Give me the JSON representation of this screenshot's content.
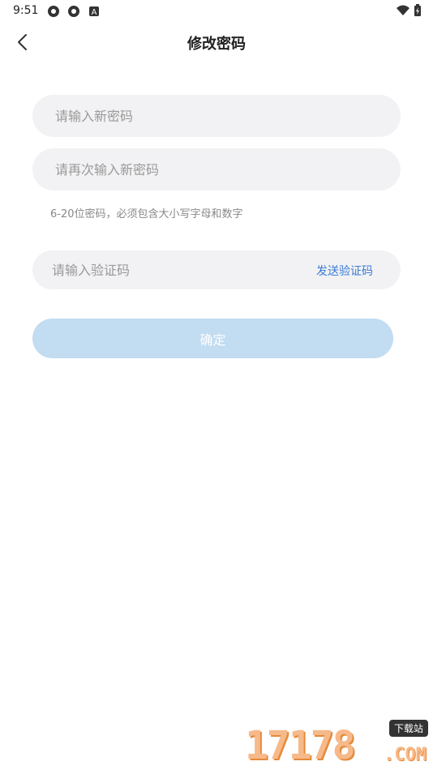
{
  "status_bar": {
    "time": "9:51",
    "icons_left": [
      "settings-gear-icon",
      "settings-gear-icon",
      "notification-a-icon"
    ],
    "icons_right": [
      "wifi-icon",
      "battery-charging-icon"
    ]
  },
  "nav": {
    "title": "修改密码",
    "back_icon": "chevron-left-icon"
  },
  "form": {
    "new_password_placeholder": "请输入新密码",
    "repeat_password_placeholder": "请再次输入新密码",
    "hint": "6-20位密码，必须包含大小写字母和数字",
    "code_placeholder": "请输入验证码",
    "send_code_label": "发送验证码",
    "confirm_label": "确定"
  },
  "colors": {
    "accent": "#3a7bd5",
    "button_disabled": "#c2dcf1",
    "field_bg": "#f2f2f4"
  },
  "watermark": {
    "digits": "17178",
    "tag": "下载站",
    "suffix": ".COM"
  }
}
